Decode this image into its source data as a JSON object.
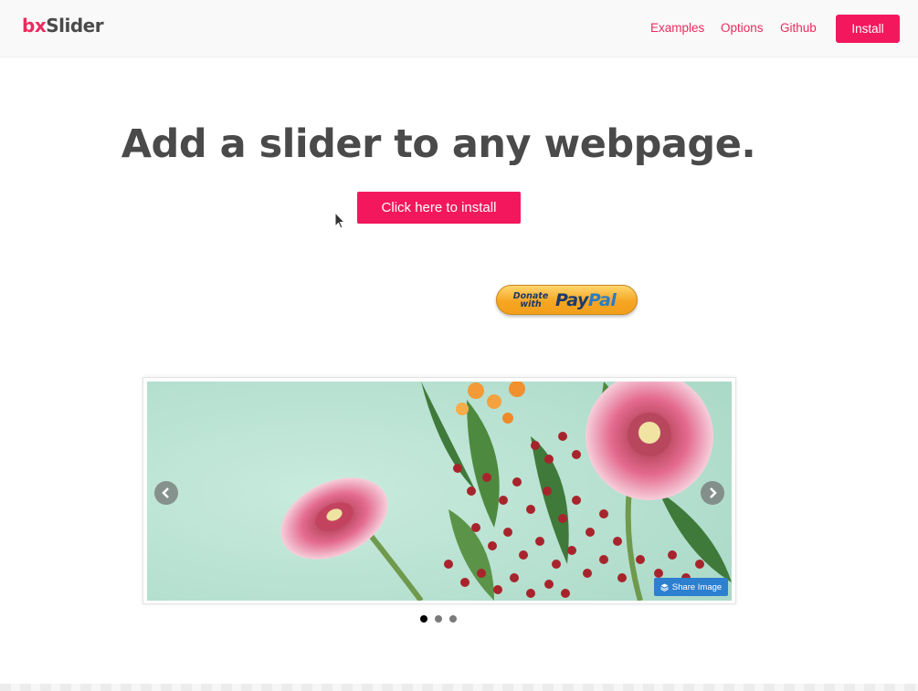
{
  "nav": {
    "logo_part1": "bx",
    "logo_part2": "Slider",
    "links": [
      "Examples",
      "Options",
      "Github"
    ],
    "install_label": "Install"
  },
  "hero": {
    "title": "Add a slider to any webpage.",
    "cta_label": "Click here to install"
  },
  "paypal": {
    "donate_line1": "Donate",
    "donate_line2": "with",
    "brand_part1": "Pay",
    "brand_part2": "Pal"
  },
  "slider": {
    "share_label": "Share Image",
    "slide_count": 3,
    "active_slide": 1,
    "prev_icon": "chevron-left-icon",
    "next_icon": "chevron-right-icon"
  },
  "colors": {
    "accent": "#f3175e",
    "logo_pink": "#ee2a5e",
    "title_gray": "#4a4a4a",
    "share_blue": "#2d7fd0",
    "slide_bg": "#bfe3d5"
  }
}
